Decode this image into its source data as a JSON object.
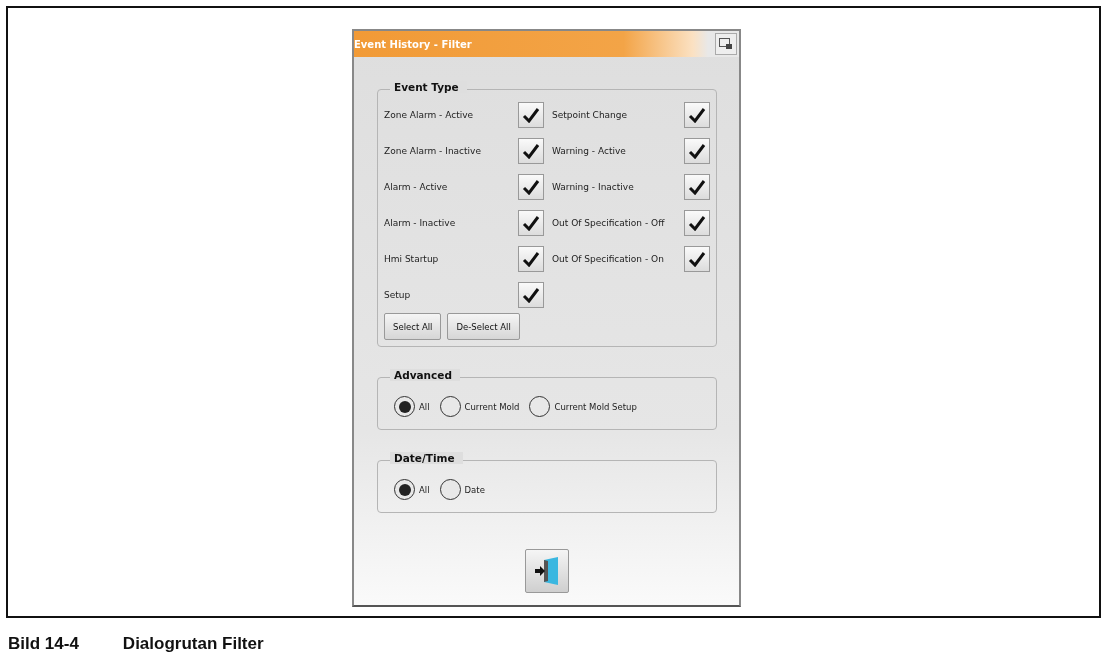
{
  "dialog": {
    "title": "Event History - Filter",
    "event_type": {
      "title": "Event Type",
      "items": [
        {
          "label": "Zone Alarm - Active",
          "checked": true
        },
        {
          "label": "Setpoint Change",
          "checked": true
        },
        {
          "label": "Zone Alarm - Inactive",
          "checked": true
        },
        {
          "label": "Warning - Active",
          "checked": true
        },
        {
          "label": "Alarm - Active",
          "checked": true
        },
        {
          "label": "Warning - Inactive",
          "checked": true
        },
        {
          "label": "Alarm - Inactive",
          "checked": true
        },
        {
          "label": "Out Of Specification - Off",
          "checked": true
        },
        {
          "label": "Hmi Startup",
          "checked": true
        },
        {
          "label": "Out Of Specification - On",
          "checked": true
        },
        {
          "label": "Setup",
          "checked": true
        }
      ],
      "buttons": [
        "Select All",
        "De-Select All"
      ]
    },
    "advanced": {
      "title": "Advanced",
      "options": [
        {
          "label": "All",
          "selected": true
        },
        {
          "label": "Current Mold",
          "selected": false
        },
        {
          "label": "Current Mold Setup",
          "selected": false
        }
      ]
    },
    "date_time": {
      "title": "Date/Time",
      "options": [
        {
          "label": "All",
          "selected": true
        },
        {
          "label": "Date",
          "selected": false
        }
      ]
    }
  },
  "caption": {
    "number": "Bild 14-4",
    "text": "Dialogrutan Filter"
  }
}
